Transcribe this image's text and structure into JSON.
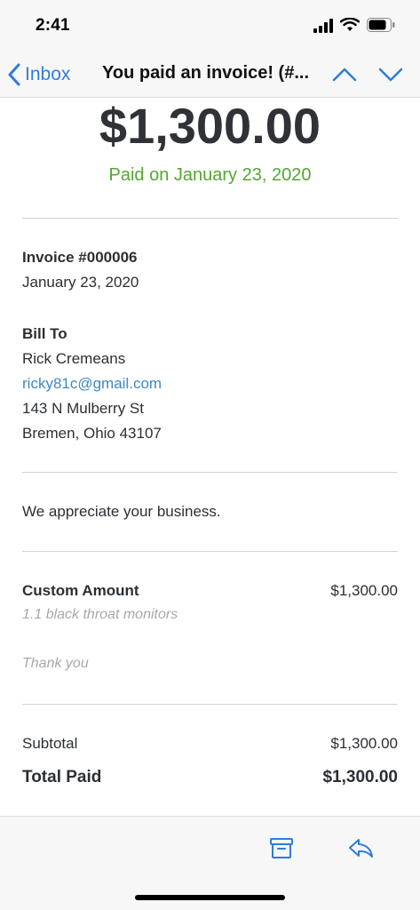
{
  "status_bar": {
    "time": "2:41"
  },
  "nav": {
    "back_label": "Inbox",
    "title": "You paid an invoice! (#..."
  },
  "invoice": {
    "amount": "$1,300.00",
    "paid_on": "Paid on January 23, 2020",
    "number": "Invoice #000006",
    "date": "January 23, 2020",
    "bill_to_label": "Bill To",
    "customer_name": "Rick Cremeans",
    "customer_email": "ricky81c@gmail.com",
    "address_line1": "143 N Mulberry St",
    "address_line2": "Bremen, Ohio 43107",
    "message": "We appreciate your business.",
    "item_name": "Custom Amount",
    "item_price": "$1,300.00",
    "item_description": "1.1 black throat monitors",
    "note": "Thank you",
    "subtotal_label": "Subtotal",
    "subtotal_value": "$1,300.00",
    "total_label": "Total Paid",
    "total_value": "$1,300.00"
  },
  "icons": {
    "back": "chevron-left-icon",
    "prev": "chevron-up-icon",
    "next": "chevron-down-icon",
    "archive": "archive-icon",
    "reply": "reply-icon"
  },
  "colors": {
    "accent": "#2e7ddb",
    "paid_green": "#55a630",
    "link": "#3f88c5"
  }
}
